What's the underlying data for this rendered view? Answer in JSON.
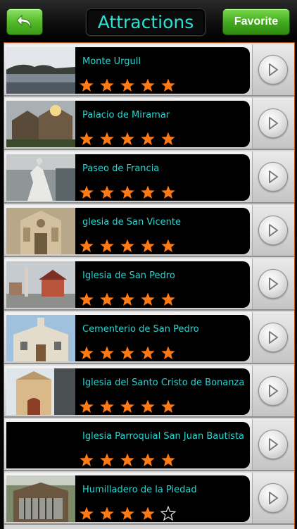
{
  "header": {
    "title": "Attractions",
    "back_icon": "back-arrow-icon",
    "favorite_label": "Favorite"
  },
  "colors": {
    "title_text": "#2ce0d2",
    "name_text": "#2bd4d0",
    "star": "#ff7a14",
    "button_green": "#55bb2a",
    "list_border": "#c0561c"
  },
  "attractions": [
    {
      "name": "Monte Urgull",
      "rating": 5,
      "thumb": "bay-hillside-photo"
    },
    {
      "name": "Palacio de Miramar",
      "rating": 5,
      "thumb": "palace-photo"
    },
    {
      "name": "Paseo de Francia",
      "rating": 5,
      "thumb": "statue-photo"
    },
    {
      "name": "glesia de San Vicente",
      "rating": 5,
      "thumb": "church-facade-photo"
    },
    {
      "name": "Iglesia de San Pedro",
      "rating": 5,
      "thumb": "church-square-photo"
    },
    {
      "name": "Cementerio de San Pedro",
      "rating": 5,
      "thumb": "chapel-photo"
    },
    {
      "name": "Iglesia del Santo Cristo de Bonanza",
      "rating": 5,
      "thumb": "street-church-photo"
    },
    {
      "name": "Iglesia Parroquial San Juan Bautista",
      "rating": 5,
      "thumb": ""
    },
    {
      "name": "Humilladero de la Piedad",
      "rating": 4,
      "thumb": "shrine-photo"
    }
  ]
}
